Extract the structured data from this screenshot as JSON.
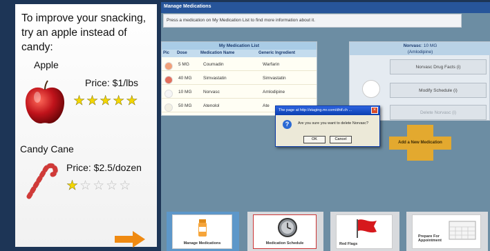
{
  "snack": {
    "tip": "To improve your snacking, try an apple instead of candy:",
    "items": [
      {
        "name": "Apple",
        "price": "Price: $1/lbs",
        "rating": 5,
        "max_rating": 5
      },
      {
        "name": "Candy Cane",
        "price": "Price: $2.5/dozen",
        "rating": 1,
        "max_rating": 5
      }
    ],
    "next_icon": "arrow-right-icon"
  },
  "app": {
    "title": "Manage Medications",
    "hint": "Press a medication on My Medication List to find more information about it.",
    "medlist": {
      "title": "My Medication List",
      "columns": [
        "Pic",
        "Dose",
        "Medication Name",
        "Generic Ingredient"
      ],
      "rows": [
        {
          "dose": "5 MG",
          "name": "Coumadin",
          "generic": "Warfarin",
          "pill_color": "#f1a07a"
        },
        {
          "dose": "40 MG",
          "name": "Simvastatin",
          "generic": "Simvastatin",
          "pill_color": "#e26f5c"
        },
        {
          "dose": "10 MG",
          "name": "Norvasc",
          "generic": "Amlodipine",
          "pill_color": "#f5f5f5"
        },
        {
          "dose": "50 MG",
          "name": "Atenolol",
          "generic": "Ate",
          "pill_color": "#f1efe2"
        }
      ]
    },
    "panel": {
      "heading": "Norvasc",
      "dose": "10 MG",
      "generic": "(Amlodipine)",
      "buttons": [
        "Norvasc Drug Facts (i)",
        "Modify Schedule  (i)",
        "Delete Norvasc (i)"
      ]
    },
    "add_label": "Add a New Medication",
    "dialog": {
      "title": "The page at http://staging.mr.com/dhtf.ch ...",
      "message": "Are you sure you want to delete Norvasc?",
      "ok": "OK",
      "cancel": "Cancel",
      "icon": "question-icon"
    },
    "tabs": [
      {
        "label": "Manage Medications",
        "icon": "pill-bottle-icon"
      },
      {
        "label": "Medication Schedule",
        "icon": "clock-icon"
      },
      {
        "label": "Red Flags",
        "icon": "red-flag-icon"
      },
      {
        "label": "Prepare For Appointment",
        "icon": "calendar-icon"
      }
    ],
    "colors": {
      "accent": "#27559a",
      "add_button": "#e3a92f",
      "active_tab": "#5d97c9"
    }
  }
}
